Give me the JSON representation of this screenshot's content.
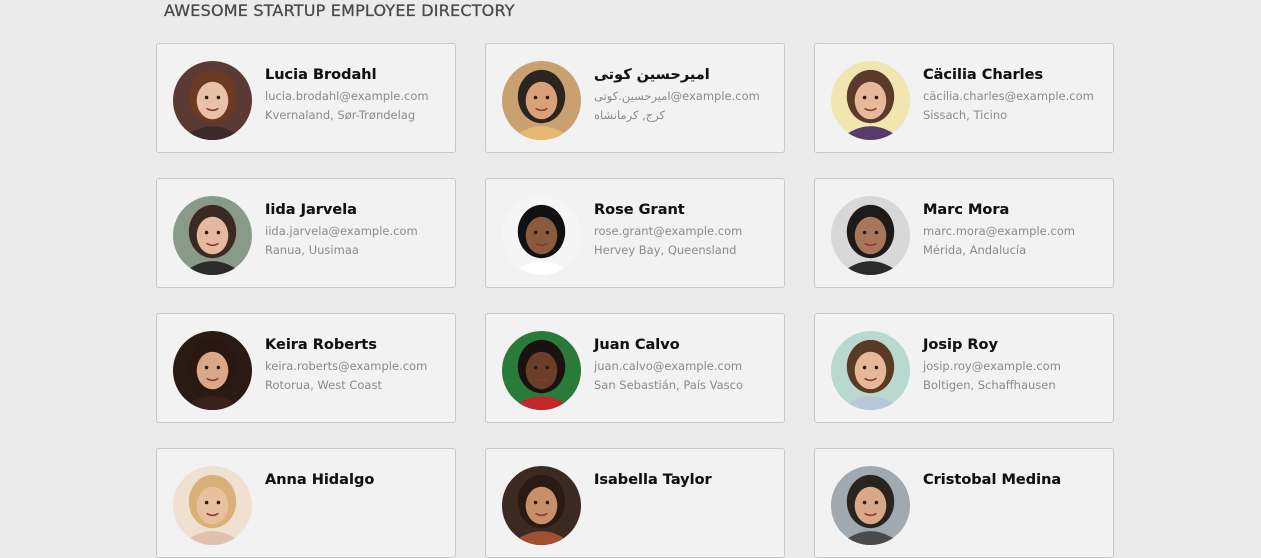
{
  "header": {
    "title": "AWESOME STARTUP EMPLOYEE DIRECTORY"
  },
  "employees": [
    {
      "name": "Lucia Brodahl",
      "email": "lucia.brodahl@example.com",
      "location": "Kvernaland, Sør-Trøndelag",
      "avatar": {
        "bg": "#5a3a32",
        "skin": "#e9c0a8",
        "hair": "#6b3a22",
        "shirt": "#3a2a2a"
      }
    },
    {
      "name": "امیرحسین کوتی",
      "email": "امیرحسین.کوتی@example.com",
      "location": "کرج, کرمانشاه",
      "avatar": {
        "bg": "#c9a070",
        "skin": "#d9a07a",
        "hair": "#2b2520",
        "shirt": "#e6b870"
      }
    },
    {
      "name": "Cäcilia Charles",
      "email": "cäcilia.charles@example.com",
      "location": "Sissach, Ticino",
      "avatar": {
        "bg": "#f2e6b0",
        "skin": "#e8b89a",
        "hair": "#5a3a2a",
        "shirt": "#5a3a6a"
      }
    },
    {
      "name": "Iida Jarvela",
      "email": "iida.jarvela@example.com",
      "location": "Ranua, Uusimaa",
      "avatar": {
        "bg": "#8a9a88",
        "skin": "#e5b8a0",
        "hair": "#3a2a22",
        "shirt": "#2a2a2a"
      }
    },
    {
      "name": "Rose Grant",
      "email": "rose.grant@example.com",
      "location": "Hervey Bay, Queensland",
      "avatar": {
        "bg": "#f5f5f5",
        "skin": "#8a5a3c",
        "hair": "#111111",
        "shirt": "#ffffff"
      }
    },
    {
      "name": "Marc Mora",
      "email": "marc.mora@example.com",
      "location": "Mérida, Andalucía",
      "avatar": {
        "bg": "#d8d8d8",
        "skin": "#a8765a",
        "hair": "#1e1a18",
        "shirt": "#2a2a2a"
      }
    },
    {
      "name": "Keira Roberts",
      "email": "keira.roberts@example.com",
      "location": "Rotorua, West Coast",
      "avatar": {
        "bg": "#2a1a14",
        "skin": "#d9a888",
        "hair": "#2a1810",
        "shirt": "#3a2018"
      }
    },
    {
      "name": "Juan Calvo",
      "email": "juan.calvo@example.com",
      "location": "San Sebastián, País Vasco",
      "avatar": {
        "bg": "#2a7a3a",
        "skin": "#6a3e28",
        "hair": "#1a1210",
        "shirt": "#c0282a"
      }
    },
    {
      "name": "Josip Roy",
      "email": "josip.roy@example.com",
      "location": "Boltigen, Schaffhausen",
      "avatar": {
        "bg": "#b8d8d0",
        "skin": "#e6b898",
        "hair": "#5a3a22",
        "shirt": "#b8c8d8"
      }
    },
    {
      "name": "Anna Hidalgo",
      "email": "",
      "location": "",
      "avatar": {
        "bg": "#f0e0d0",
        "skin": "#e8c0a0",
        "hair": "#d8b078",
        "shirt": "#e0c0b0"
      }
    },
    {
      "name": "Isabella Taylor",
      "email": "",
      "location": "",
      "avatar": {
        "bg": "#3a2a22",
        "skin": "#c8906a",
        "hair": "#2a1a12",
        "shirt": "#a05030"
      }
    },
    {
      "name": "Cristobal Medina",
      "email": "",
      "location": "",
      "avatar": {
        "bg": "#a0a8b0",
        "skin": "#d8a888",
        "hair": "#2a2420",
        "shirt": "#4a4a4a"
      }
    }
  ]
}
